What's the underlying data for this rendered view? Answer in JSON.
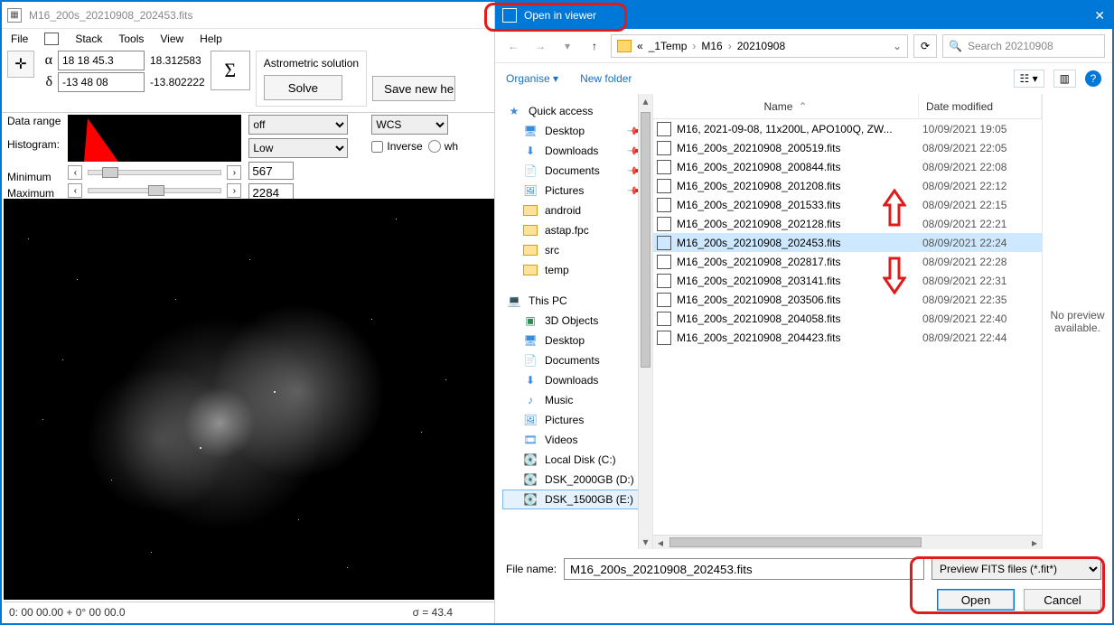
{
  "astap": {
    "title": "M16_200s_20210908_202453.fits",
    "menu": {
      "file": "File",
      "stack": "Stack",
      "tools": "Tools",
      "view": "View",
      "help": "Help"
    },
    "alpha_input": "18 18 45.3",
    "alpha_dec": "18.312583",
    "delta_input": "-13 48 08",
    "delta_dec": "-13.802222",
    "astro_label": "Astrometric solution",
    "solve": "Solve",
    "save_hdr": "Save new he",
    "data_range": "Data range",
    "histogram": "Histogram:",
    "minimum": "Minimum",
    "maximum": "Maximum",
    "min_val": "567",
    "max_val": "2284",
    "sel_off": "off",
    "sel_low": "Low",
    "wcs": "WCS",
    "inverse": "Inverse",
    "inverse_trunc": "wh",
    "status_coords": "0: 00  00.00   + 0° 00  00.0",
    "status_sigma": "σ = 43.4"
  },
  "dialog": {
    "title": "Open in viewer",
    "breadcrumb": {
      "root": "«",
      "p1": "_1Temp",
      "p2": "M16",
      "p3": "20210908"
    },
    "search_placeholder": "Search 20210908",
    "organise": "Organise",
    "new_folder": "New folder",
    "col_name": "Name",
    "col_date": "Date modified",
    "preview_msg": "No preview available.",
    "filename_label": "File name:",
    "filename_value": "M16_200s_20210908_202453.fits",
    "filter": "Preview FITS files (*.fit*)",
    "open": "Open",
    "cancel": "Cancel",
    "nav": {
      "quick": "Quick access",
      "desktop": "Desktop",
      "downloads": "Downloads",
      "documents": "Documents",
      "pictures": "Pictures",
      "android": "android",
      "astap": "astap.fpc",
      "src": "src",
      "temp": "temp",
      "thispc": "This PC",
      "objects3d": "3D Objects",
      "desktop2": "Desktop",
      "documents2": "Documents",
      "downloads2": "Downloads",
      "music": "Music",
      "pictures2": "Pictures",
      "videos": "Videos",
      "localc": "Local Disk (C:)",
      "dsk2000": "DSK_2000GB (D:)",
      "dsk1500": "DSK_1500GB (E:)"
    },
    "files": [
      {
        "name": "M16, 2021-09-08, 11x200L, APO100Q, ZW...",
        "date": "10/09/2021 19:05",
        "sel": false
      },
      {
        "name": "M16_200s_20210908_200519.fits",
        "date": "08/09/2021 22:05",
        "sel": false
      },
      {
        "name": "M16_200s_20210908_200844.fits",
        "date": "08/09/2021 22:08",
        "sel": false
      },
      {
        "name": "M16_200s_20210908_201208.fits",
        "date": "08/09/2021 22:12",
        "sel": false
      },
      {
        "name": "M16_200s_20210908_201533.fits",
        "date": "08/09/2021 22:15",
        "sel": false
      },
      {
        "name": "M16_200s_20210908_202128.fits",
        "date": "08/09/2021 22:21",
        "sel": false
      },
      {
        "name": "M16_200s_20210908_202453.fits",
        "date": "08/09/2021 22:24",
        "sel": true
      },
      {
        "name": "M16_200s_20210908_202817.fits",
        "date": "08/09/2021 22:28",
        "sel": false
      },
      {
        "name": "M16_200s_20210908_203141.fits",
        "date": "08/09/2021 22:31",
        "sel": false
      },
      {
        "name": "M16_200s_20210908_203506.fits",
        "date": "08/09/2021 22:35",
        "sel": false
      },
      {
        "name": "M16_200s_20210908_204058.fits",
        "date": "08/09/2021 22:40",
        "sel": false
      },
      {
        "name": "M16_200s_20210908_204423.fits",
        "date": "08/09/2021 22:44",
        "sel": false
      }
    ]
  }
}
